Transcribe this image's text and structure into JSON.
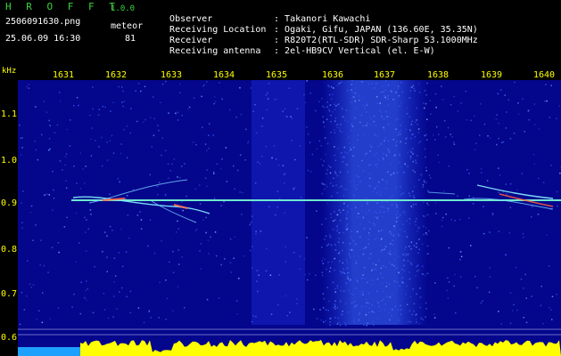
{
  "header": {
    "app_name": "H R O F F T",
    "app_version": "1.0.0",
    "file_name": "2506091630.png",
    "date_time": "25.06.09 16:30",
    "mode_label": "meteor",
    "count_value": "81"
  },
  "info": [
    {
      "label": "Observer",
      "value": "Takanori Kawachi"
    },
    {
      "label": "Receiving Location",
      "value": "Ogaki, Gifu, JAPAN (136.60E, 35.35N)"
    },
    {
      "label": "Receiver",
      "value": "R820T2(RTL-SDR) SDR-Sharp 53.1000MHz"
    },
    {
      "label": "Receiving antenna",
      "value": "2el-HB9CV Vertical (el. E-W)"
    }
  ],
  "axes": {
    "y_unit": "kHz",
    "x_ticks": [
      "1631",
      "1632",
      "1633",
      "1634",
      "1635",
      "1636",
      "1637",
      "1638",
      "1639",
      "1640"
    ],
    "y_ticks": [
      "1.1",
      "1.0",
      "0.9",
      "0.8",
      "0.7",
      "0.6"
    ]
  },
  "colors": {
    "background": "#04068c",
    "label": "#ffff00",
    "title": "#39d63c",
    "carrier": "#6fe8d0",
    "level": "#ffff00"
  }
}
